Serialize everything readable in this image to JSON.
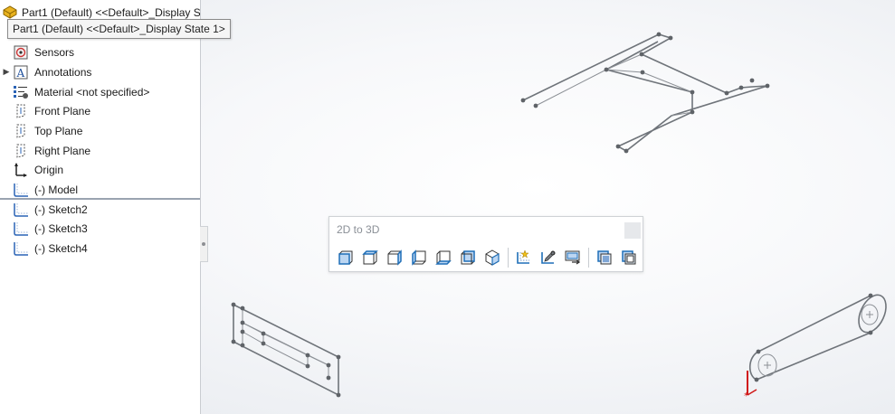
{
  "tree": {
    "root_label": "Part1 (Default) <<Default>_Display State 1>",
    "tooltip": "Part1 (Default) <<Default>_Display State 1>",
    "items": [
      {
        "label": "Sensors",
        "icon": "sensor-icon",
        "expandable": false
      },
      {
        "label": "Annotations",
        "icon": "annotations-icon",
        "expandable": true
      },
      {
        "label": "Material <not specified>",
        "icon": "material-icon",
        "expandable": false
      },
      {
        "label": "Front Plane",
        "icon": "plane-icon",
        "expandable": false
      },
      {
        "label": "Top Plane",
        "icon": "plane-icon",
        "expandable": false
      },
      {
        "label": "Right Plane",
        "icon": "plane-icon",
        "expandable": false
      },
      {
        "label": "Origin",
        "icon": "origin-icon",
        "expandable": false
      },
      {
        "label": "(-) Model",
        "icon": "sketch-icon",
        "expandable": false
      },
      {
        "label": "(-) Sketch2",
        "icon": "sketch-icon",
        "expandable": false
      },
      {
        "label": "(-) Sketch3",
        "icon": "sketch-icon",
        "expandable": false
      },
      {
        "label": "(-) Sketch4",
        "icon": "sketch-icon",
        "expandable": false
      }
    ]
  },
  "toolbar": {
    "title": "2D to 3D",
    "buttons": [
      {
        "icon": "front-view-icon"
      },
      {
        "icon": "top-view-icon"
      },
      {
        "icon": "right-view-icon"
      },
      {
        "icon": "left-view-icon"
      },
      {
        "icon": "bottom-view-icon"
      },
      {
        "icon": "back-view-icon"
      },
      {
        "icon": "auxiliary-view-icon"
      },
      {
        "icon": "create-sketch-icon"
      },
      {
        "icon": "repair-sketch-icon"
      },
      {
        "icon": "align-sketch-icon"
      },
      {
        "icon": "extrude-icon"
      },
      {
        "icon": "cut-icon"
      }
    ]
  },
  "colors": {
    "sketch_line": "#6f747a",
    "accent_blue": "#1f6fb8",
    "origin_red": "#d01818",
    "icon_gold": "#d9a11a"
  }
}
